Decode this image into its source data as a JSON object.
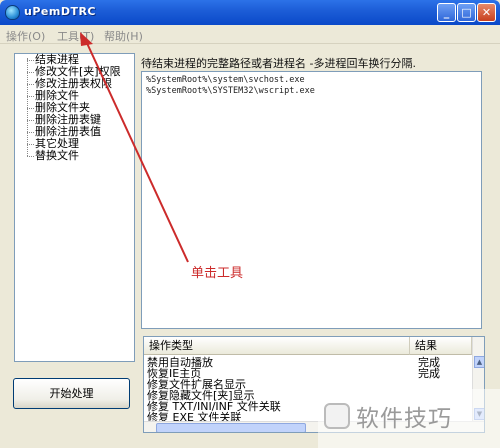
{
  "window": {
    "title": "uPemDTRC",
    "controls": {
      "min": "_",
      "max": "□",
      "close": "✕"
    }
  },
  "menu": {
    "items": [
      "操作(O)",
      "工具(T)",
      "帮助(H)"
    ]
  },
  "sidebar": {
    "items": [
      "结束进程",
      "修改文件[夹]权限",
      "修改注册表权限",
      "删除文件",
      "删除文件夹",
      "删除注册表键",
      "删除注册表值",
      "其它处理",
      "替换文件"
    ],
    "start_button": "开始处理"
  },
  "main": {
    "label": "待结束进程的完整路径或者进程名 -多进程回车换行分隔.",
    "paths": [
      "%SystemRoot%\\system\\svchost.exe",
      "%SystemRoot%\\SYSTEM32\\wscript.exe"
    ]
  },
  "annotation": {
    "text": "单击工具",
    "color": "#cc2b2b"
  },
  "table": {
    "headers": {
      "type": "操作类型",
      "result": "结果"
    },
    "rows": [
      {
        "type": "禁用自动播放",
        "result": "完成"
      },
      {
        "type": "恢复IE主页",
        "result": "完成"
      },
      {
        "type": "修复文件扩展名显示",
        "result": ""
      },
      {
        "type": "修复隐藏文件[夹]显示",
        "result": ""
      },
      {
        "type": "修复 TXT/INI/INF 文件关联",
        "result": ""
      },
      {
        "type": "修复 EXE 文件关联",
        "result": ""
      }
    ]
  },
  "watermark": {
    "text": "软件技巧"
  }
}
